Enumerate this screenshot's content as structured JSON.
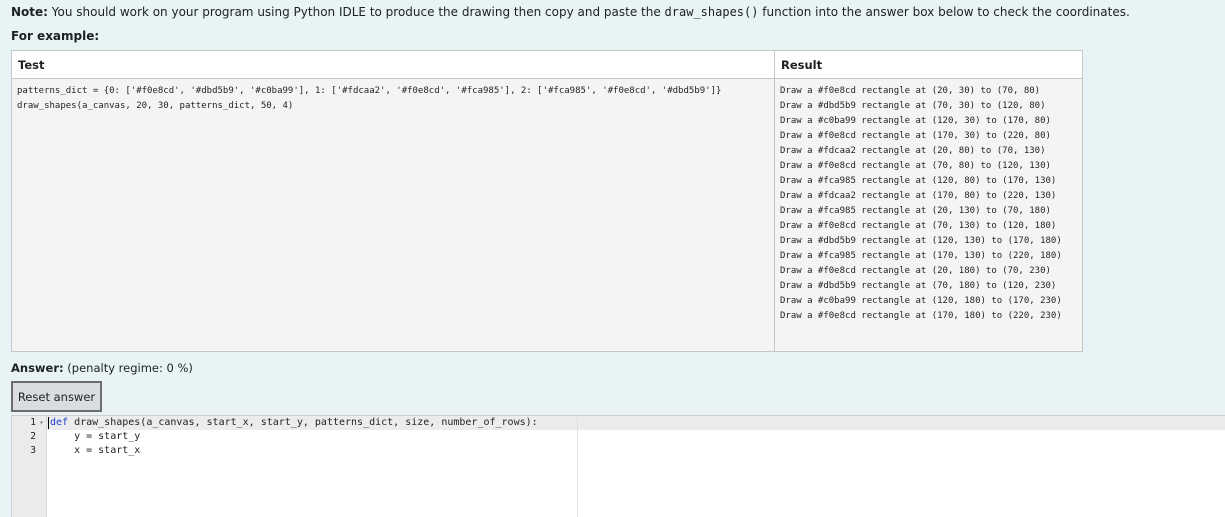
{
  "note": {
    "label": "Note:",
    "text_before": "You should work on your program using Python IDLE to produce the drawing then copy and paste the",
    "code": "draw_shapes()",
    "text_after": "function into the answer box below to check the coordinates."
  },
  "example_heading": "For example:",
  "table": {
    "headers": {
      "test": "Test",
      "result": "Result"
    },
    "test_lines": [
      "patterns_dict = {0: ['#f0e8cd', '#dbd5b9', '#c0ba99'], 1: ['#fdcaa2', '#f0e8cd', '#fca985'], 2: ['#fca985', '#f0e8cd', '#dbd5b9']}",
      "draw_shapes(a_canvas, 20, 30, patterns_dict, 50, 4)"
    ],
    "result_lines": [
      "Draw a #f0e8cd rectangle at (20, 30) to (70, 80)",
      "Draw a #dbd5b9 rectangle at (70, 30) to (120, 80)",
      "Draw a #c0ba99 rectangle at (120, 30) to (170, 80)",
      "Draw a #f0e8cd rectangle at (170, 30) to (220, 80)",
      "Draw a #fdcaa2 rectangle at (20, 80) to (70, 130)",
      "Draw a #f0e8cd rectangle at (70, 80) to (120, 130)",
      "Draw a #fca985 rectangle at (120, 80) to (170, 130)",
      "Draw a #fdcaa2 rectangle at (170, 80) to (220, 130)",
      "Draw a #fca985 rectangle at (20, 130) to (70, 180)",
      "Draw a #f0e8cd rectangle at (70, 130) to (120, 180)",
      "Draw a #dbd5b9 rectangle at (120, 130) to (170, 180)",
      "Draw a #fca985 rectangle at (170, 130) to (220, 180)",
      "Draw a #f0e8cd rectangle at (20, 180) to (70, 230)",
      "Draw a #dbd5b9 rectangle at (70, 180) to (120, 230)",
      "Draw a #c0ba99 rectangle at (120, 180) to (170, 230)",
      "Draw a #f0e8cd rectangle at (170, 180) to (220, 230)"
    ]
  },
  "answer": {
    "label": "Answer:",
    "penalty": "(penalty regime: 0 %)",
    "reset_label": "Reset answer"
  },
  "editor": {
    "line_numbers": [
      "1",
      "2",
      "3"
    ],
    "fold_marker": "▾",
    "keyword": "def",
    "line1_rest": " draw_shapes(a_canvas, start_x, start_y, patterns_dict, size, number_of_rows):",
    "line2": "    y = start_y",
    "line3": "    x = start_x"
  },
  "colors": {
    "page_background": "#e7f3f5",
    "keyword": "#1b3bd0"
  }
}
